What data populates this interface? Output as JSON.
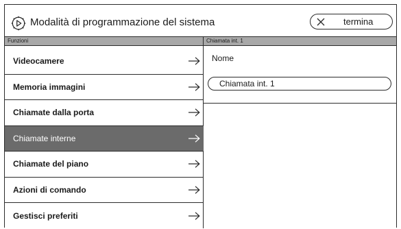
{
  "header": {
    "title": "Modalità di programmazione del sistema",
    "end_button_label": "termina",
    "settings_icon": "gear-icon",
    "close_icon": "close-icon"
  },
  "left_panel": {
    "header": "Funzioni",
    "items": [
      {
        "label": "Videocamere",
        "selected": false
      },
      {
        "label": "Memoria immagini",
        "selected": false
      },
      {
        "label": "Chiamate dalla porta",
        "selected": false
      },
      {
        "label": "Chiamate interne",
        "selected": true
      },
      {
        "label": "Chiamate del piano",
        "selected": false
      },
      {
        "label": "Azioni di comando",
        "selected": false
      },
      {
        "label": "Gestisci preferiti",
        "selected": false
      }
    ]
  },
  "right_panel": {
    "header": "Chiamata int. 1",
    "name_label": "Nome",
    "name_value": "Chiamata int. 1"
  },
  "colors": {
    "selected_bg": "#6b6b6b",
    "pane_header_bg": "#a8a8a8",
    "border": "#2b2b2b"
  }
}
